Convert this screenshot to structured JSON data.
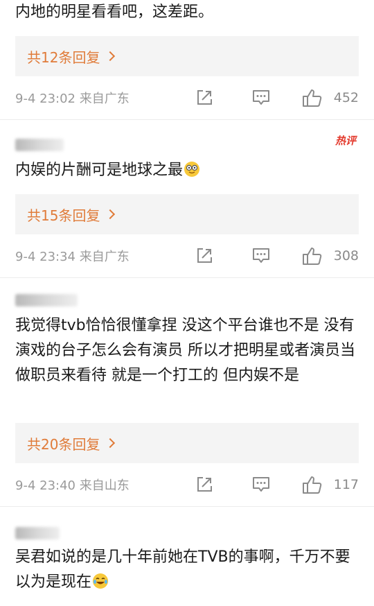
{
  "comments": [
    {
      "text": "内地的明星看看吧，这差距。",
      "replies": "共12条回复",
      "time": "9-4 23:02 来自广东",
      "likes": "452"
    },
    {
      "hot_badge": "热评",
      "text": "内娱的片酬可是地球之最",
      "replies": "共15条回复",
      "time": "9-4 23:34 来自广东",
      "likes": "308"
    },
    {
      "text": "我觉得tvb恰恰很懂拿捏 没这个平台谁也不是 没有演戏的台子怎么会有演员 所以才把明星或者演员当做职员来看待 就是一个打工的 但内娱不是",
      "replies": "共20条回复",
      "time": "9-4 23:40 来自山东",
      "likes": "117"
    },
    {
      "text": "吴君如说的是几十年前她在TVB的事啊，千万不要以为是现在"
    }
  ],
  "icons": {
    "share": "share-icon",
    "comment": "comment-icon",
    "like": "thumbs-up-icon",
    "emoji_glasses": "nerd-face-emoji",
    "emoji_laugh": "laughing-tears-emoji"
  },
  "colors": {
    "reply_link": "#e07b39",
    "hot_badge": "#e33a2d",
    "meta_text": "#9a9a9a"
  }
}
